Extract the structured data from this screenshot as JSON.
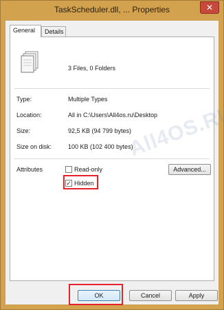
{
  "window": {
    "title": "TaskScheduler.dll, ... Properties",
    "close_glyph": "✕"
  },
  "tabs": [
    {
      "label": "General",
      "active": true
    },
    {
      "label": "Details",
      "active": false
    }
  ],
  "general": {
    "summary": "3 Files, 0 Folders",
    "rows": [
      {
        "label": "Type:",
        "value": "Multiple Types"
      },
      {
        "label": "Location:",
        "value": "All in C:\\Users\\All4os.ru\\Desktop"
      },
      {
        "label": "Size:",
        "value": "92,5 KB (94 799 bytes)"
      },
      {
        "label": "Size on disk:",
        "value": "100 KB (102 400 bytes)"
      }
    ],
    "attributes_label": "Attributes",
    "readonly": {
      "label": "Read-only",
      "checked": false
    },
    "hidden": {
      "label": "Hidden",
      "checked": true,
      "check_glyph": "✓"
    },
    "advanced_label": "Advanced..."
  },
  "buttons": {
    "ok": "OK",
    "cancel": "Cancel",
    "apply": "Apply"
  },
  "watermark": "All4OS.RU",
  "colors": {
    "frame": "#d3a24f",
    "highlight": "#e3222a"
  }
}
